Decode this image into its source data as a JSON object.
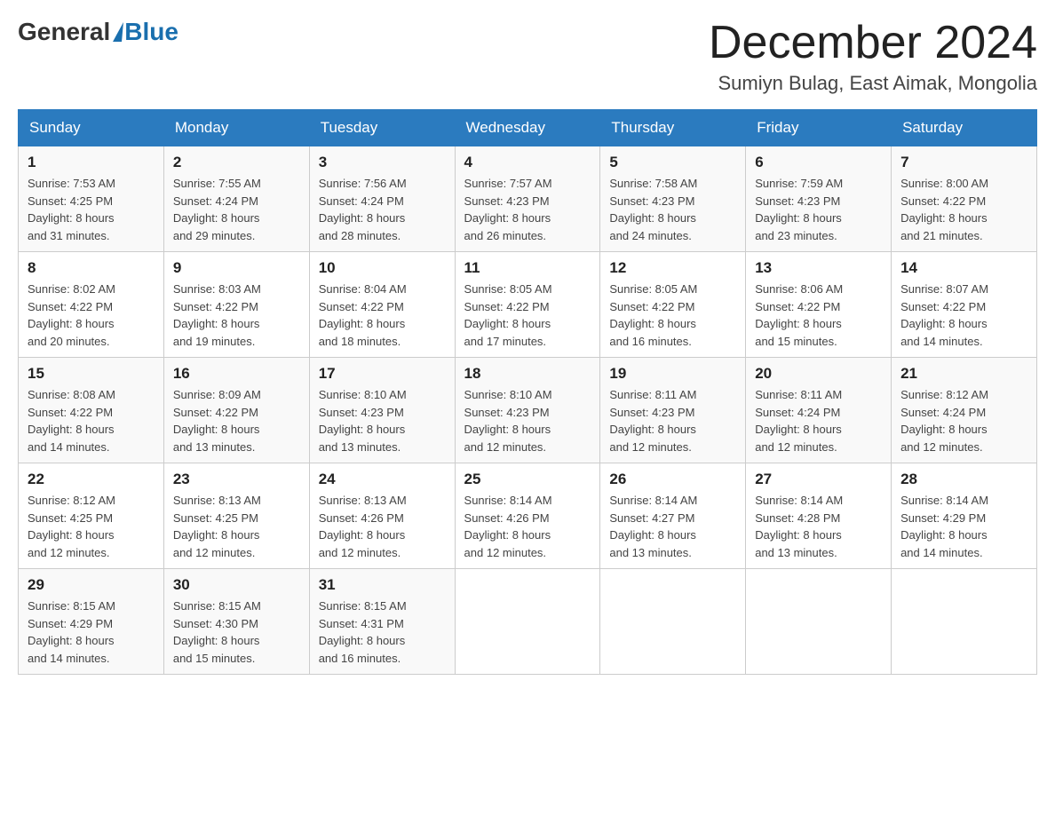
{
  "header": {
    "logo": {
      "general": "General",
      "blue": "Blue"
    },
    "title": "December 2024",
    "location": "Sumiyn Bulag, East Aimak, Mongolia"
  },
  "calendar": {
    "headers": [
      "Sunday",
      "Monday",
      "Tuesday",
      "Wednesday",
      "Thursday",
      "Friday",
      "Saturday"
    ],
    "weeks": [
      [
        {
          "day": "1",
          "sunrise": "7:53 AM",
          "sunset": "4:25 PM",
          "daylight": "8 hours and 31 minutes."
        },
        {
          "day": "2",
          "sunrise": "7:55 AM",
          "sunset": "4:24 PM",
          "daylight": "8 hours and 29 minutes."
        },
        {
          "day": "3",
          "sunrise": "7:56 AM",
          "sunset": "4:24 PM",
          "daylight": "8 hours and 28 minutes."
        },
        {
          "day": "4",
          "sunrise": "7:57 AM",
          "sunset": "4:23 PM",
          "daylight": "8 hours and 26 minutes."
        },
        {
          "day": "5",
          "sunrise": "7:58 AM",
          "sunset": "4:23 PM",
          "daylight": "8 hours and 24 minutes."
        },
        {
          "day": "6",
          "sunrise": "7:59 AM",
          "sunset": "4:23 PM",
          "daylight": "8 hours and 23 minutes."
        },
        {
          "day": "7",
          "sunrise": "8:00 AM",
          "sunset": "4:22 PM",
          "daylight": "8 hours and 21 minutes."
        }
      ],
      [
        {
          "day": "8",
          "sunrise": "8:02 AM",
          "sunset": "4:22 PM",
          "daylight": "8 hours and 20 minutes."
        },
        {
          "day": "9",
          "sunrise": "8:03 AM",
          "sunset": "4:22 PM",
          "daylight": "8 hours and 19 minutes."
        },
        {
          "day": "10",
          "sunrise": "8:04 AM",
          "sunset": "4:22 PM",
          "daylight": "8 hours and 18 minutes."
        },
        {
          "day": "11",
          "sunrise": "8:05 AM",
          "sunset": "4:22 PM",
          "daylight": "8 hours and 17 minutes."
        },
        {
          "day": "12",
          "sunrise": "8:05 AM",
          "sunset": "4:22 PM",
          "daylight": "8 hours and 16 minutes."
        },
        {
          "day": "13",
          "sunrise": "8:06 AM",
          "sunset": "4:22 PM",
          "daylight": "8 hours and 15 minutes."
        },
        {
          "day": "14",
          "sunrise": "8:07 AM",
          "sunset": "4:22 PM",
          "daylight": "8 hours and 14 minutes."
        }
      ],
      [
        {
          "day": "15",
          "sunrise": "8:08 AM",
          "sunset": "4:22 PM",
          "daylight": "8 hours and 14 minutes."
        },
        {
          "day": "16",
          "sunrise": "8:09 AM",
          "sunset": "4:22 PM",
          "daylight": "8 hours and 13 minutes."
        },
        {
          "day": "17",
          "sunrise": "8:10 AM",
          "sunset": "4:23 PM",
          "daylight": "8 hours and 13 minutes."
        },
        {
          "day": "18",
          "sunrise": "8:10 AM",
          "sunset": "4:23 PM",
          "daylight": "8 hours and 12 minutes."
        },
        {
          "day": "19",
          "sunrise": "8:11 AM",
          "sunset": "4:23 PM",
          "daylight": "8 hours and 12 minutes."
        },
        {
          "day": "20",
          "sunrise": "8:11 AM",
          "sunset": "4:24 PM",
          "daylight": "8 hours and 12 minutes."
        },
        {
          "day": "21",
          "sunrise": "8:12 AM",
          "sunset": "4:24 PM",
          "daylight": "8 hours and 12 minutes."
        }
      ],
      [
        {
          "day": "22",
          "sunrise": "8:12 AM",
          "sunset": "4:25 PM",
          "daylight": "8 hours and 12 minutes."
        },
        {
          "day": "23",
          "sunrise": "8:13 AM",
          "sunset": "4:25 PM",
          "daylight": "8 hours and 12 minutes."
        },
        {
          "day": "24",
          "sunrise": "8:13 AM",
          "sunset": "4:26 PM",
          "daylight": "8 hours and 12 minutes."
        },
        {
          "day": "25",
          "sunrise": "8:14 AM",
          "sunset": "4:26 PM",
          "daylight": "8 hours and 12 minutes."
        },
        {
          "day": "26",
          "sunrise": "8:14 AM",
          "sunset": "4:27 PM",
          "daylight": "8 hours and 13 minutes."
        },
        {
          "day": "27",
          "sunrise": "8:14 AM",
          "sunset": "4:28 PM",
          "daylight": "8 hours and 13 minutes."
        },
        {
          "day": "28",
          "sunrise": "8:14 AM",
          "sunset": "4:29 PM",
          "daylight": "8 hours and 14 minutes."
        }
      ],
      [
        {
          "day": "29",
          "sunrise": "8:15 AM",
          "sunset": "4:29 PM",
          "daylight": "8 hours and 14 minutes."
        },
        {
          "day": "30",
          "sunrise": "8:15 AM",
          "sunset": "4:30 PM",
          "daylight": "8 hours and 15 minutes."
        },
        {
          "day": "31",
          "sunrise": "8:15 AM",
          "sunset": "4:31 PM",
          "daylight": "8 hours and 16 minutes."
        },
        null,
        null,
        null,
        null
      ]
    ]
  }
}
